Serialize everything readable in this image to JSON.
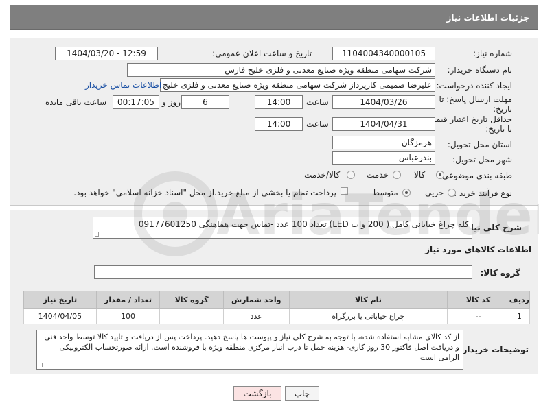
{
  "header": {
    "title": "جزئیات اطلاعات نیاز"
  },
  "form": {
    "need_number_label": "شماره نیاز:",
    "need_number": "1104004340000105",
    "announce_label": "تاریخ و ساعت اعلان عمومی:",
    "announce_value": "1404/03/20 - 12:59",
    "buyer_org_label": "نام دستگاه خریدار:",
    "buyer_org": "شرکت سهامی منطقه ویژه صنایع معدنی و فلزی خلیج فارس",
    "creator_label": "ایجاد کننده درخواست:",
    "creator": "علیرضا صمیمی کارپرداز شرکت سهامی منطقه ویژه صنایع معدنی و فلزی خلیج فارس",
    "contact_link": "اطلاعات تماس خریدار",
    "deadline_label_1": "مهلت ارسال پاسخ: تا",
    "deadline_label_2": "تاریخ:",
    "deadline_date": "1404/03/26",
    "time_label": "ساعت",
    "deadline_time": "14:00",
    "days_value": "6",
    "days_label": "روز و",
    "remaining_value": "00:17:05",
    "remaining_label": "ساعت باقی مانده",
    "min_price_label_1": "حداقل تاریخ اعتبار قیمت:",
    "min_price_label_2": "تا تاریخ:",
    "min_price_date": "1404/04/31",
    "min_price_time": "14:00",
    "province_label": "استان محل تحویل:",
    "province": "هرمزگان",
    "city_label": "شهر محل تحویل:",
    "city": "بندرعباس",
    "category_label": "طبقه بندی موضوعی:",
    "category_options": [
      "کالا",
      "خدمت",
      "کالا/خدمت"
    ],
    "category_selected": "کالا",
    "process_label": "نوع فرآیند خرید :",
    "process_options": [
      "جزیی",
      "متوسط"
    ],
    "process_selected": "متوسط",
    "payment_note": "پرداخت تمام یا بخشی از مبلغ خرید،از محل \"اسناد خزانه اسلامی\" خواهد بود."
  },
  "description": {
    "label": "شرح کلی نیاز:",
    "value": "کله چراغ خیابانی کامل ( 200 وات LED) تعداد 100 عدد -تماس جهت هماهنگی 09177601250"
  },
  "goods_section": {
    "title": "اطلاعات کالاهای مورد نیاز",
    "group_label": "گروه کالا:",
    "group_value": ""
  },
  "table": {
    "headers": [
      "ردیف",
      "کد کالا",
      "نام کالا",
      "واحد شمارش",
      "گروه کالا",
      "تعداد / مقدار",
      "تاریخ نیاز"
    ],
    "rows": [
      [
        "1",
        "--",
        "چراغ خیابانی یا بزرگراه",
        "عدد",
        "",
        "100",
        "1404/04/05"
      ]
    ]
  },
  "buyer_notes": {
    "label": "توضیحات خریدار:",
    "value": "از کد کالای مشابه استفاده شده، با توجه به شرح کلی نیاز و پیوست ها پاسخ دهید. پرداخت پس از دریافت و تایید کالا توسط واحد فنی و دریافت اصل فاکتور 30 روز کاری- هزینه حمل تا درب انبار مرکزی منطقه ویژه با فروشنده است. ارائه صورتحساب الکترونیکی الزامی است"
  },
  "buttons": {
    "print": "چاپ",
    "back": "بازگشت"
  },
  "watermark_text": "AriaTender.net"
}
